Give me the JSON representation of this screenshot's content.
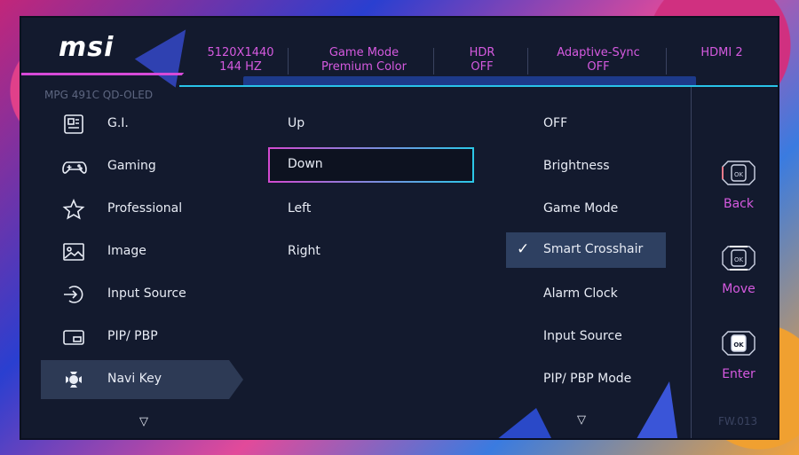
{
  "header": {
    "logo": "msi",
    "model": "MPG 491C QD-OLED",
    "stats": [
      {
        "line1": "5120X1440",
        "line2": "144 HZ"
      },
      {
        "line1": "Game Mode",
        "line2": "Premium Color"
      },
      {
        "line1": "HDR",
        "line2": "OFF"
      },
      {
        "line1": "Adaptive-Sync",
        "line2": "OFF"
      },
      {
        "line1": "HDMI 2",
        "line2": ""
      }
    ]
  },
  "menu": {
    "items": [
      {
        "label": "G.I.",
        "icon": "gi-icon"
      },
      {
        "label": "Gaming",
        "icon": "gamepad-icon"
      },
      {
        "label": "Professional",
        "icon": "star-icon"
      },
      {
        "label": "Image",
        "icon": "image-icon"
      },
      {
        "label": "Input Source",
        "icon": "input-source-icon"
      },
      {
        "label": "PIP/ PBP",
        "icon": "pip-icon"
      },
      {
        "label": "Navi Key",
        "icon": "navi-key-icon"
      }
    ],
    "active_index": 6
  },
  "directions": {
    "items": [
      "Up",
      "Down",
      "Left",
      "Right"
    ],
    "selected_index": 1
  },
  "options": {
    "items": [
      "OFF",
      "Brightness",
      "Game Mode",
      "Smart Crosshair",
      "Alarm Clock",
      "Input Source",
      "PIP/ PBP Mode"
    ],
    "checked_index": 3
  },
  "controls": [
    {
      "label": "Back",
      "icon": "ok-left-icon"
    },
    {
      "label": "Move",
      "icon": "ok-updown-icon"
    },
    {
      "label": "Enter",
      "icon": "ok-press-icon"
    }
  ],
  "firmware": "FW.013",
  "colors": {
    "accent_magenta": "#d65ae0",
    "accent_cyan": "#29c3e8",
    "panel_bg": "#131a2e",
    "highlight": "#2e4061"
  }
}
